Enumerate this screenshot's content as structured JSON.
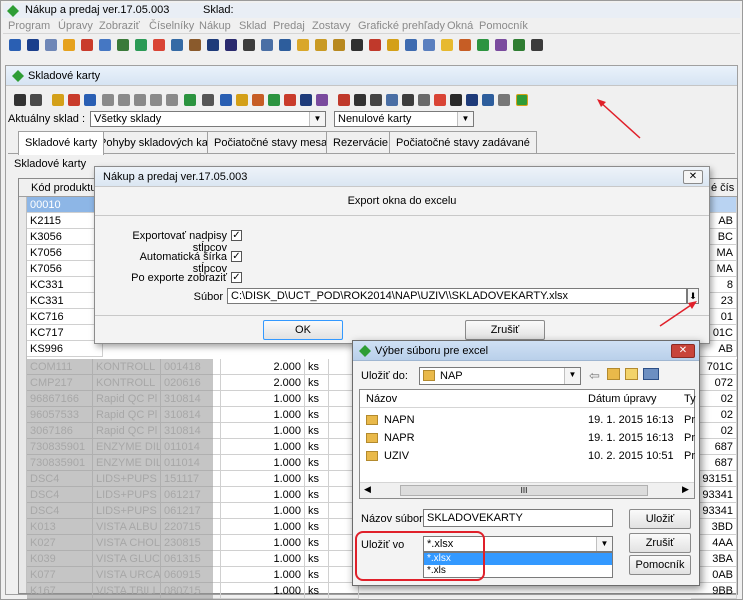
{
  "app": {
    "title": "Nákup a predaj ver.17.05.003",
    "sklad_label": "Sklad:"
  },
  "menu": [
    "Program",
    "Úpravy",
    "Zobraziť",
    "Číselníky",
    "Nákup",
    "Sklad",
    "Predaj",
    "Zostavy",
    "Grafické prehľady",
    "Okná",
    "Pomocník"
  ],
  "child": {
    "title": "Skladové karty",
    "sklad_label": "Aktuálny sklad :",
    "sklad_value": "Všetky sklady",
    "filter_value": "Nenulové karty",
    "grid_title": "Skladové karty",
    "col_kod": "Kód produktu",
    "col_right": "é čís"
  },
  "tabs": [
    "Skladové karty",
    "Pohyby skladových kariet",
    "Počiatočné stavy mesačné",
    "Rezervácie",
    "Počiatočné stavy zadávané"
  ],
  "rows_top": [
    {
      "kod": "00010",
      "r": ""
    },
    {
      "kod": "K2115",
      "r": "AB"
    },
    {
      "kod": "K3056",
      "r": "BC"
    },
    {
      "kod": "K7056",
      "r": "MA"
    },
    {
      "kod": "K7056",
      "r": "MA"
    },
    {
      "kod": "KC331",
      "r": "8"
    },
    {
      "kod": "KC331",
      "r": "23"
    },
    {
      "kod": "KC716",
      "r": "01"
    },
    {
      "kod": "KC717",
      "r": "01C"
    },
    {
      "kod": "KS996",
      "r": "AB"
    }
  ],
  "rows_bottom": [
    {
      "kod": "COM111",
      "nazov": "KONTROLL",
      "kod2": "001418",
      "qty": "2.000",
      "unit": "ks",
      "r": "701C"
    },
    {
      "kod": "CMP217",
      "nazov": "KONTROLL",
      "kod2": "020616",
      "qty": "2.000",
      "unit": "ks",
      "r": "072"
    },
    {
      "kod": "96867166",
      "nazov": "Rapid QC Pl",
      "kod2": "310814",
      "qty": "1.000",
      "unit": "ks",
      "r": "02"
    },
    {
      "kod": "96057533",
      "nazov": "Rapid QC Pl",
      "kod2": "310814",
      "qty": "1.000",
      "unit": "ks",
      "r": "02"
    },
    {
      "kod": "3067186",
      "nazov": "Rapid QC Pl",
      "kod2": "310814",
      "qty": "1.000",
      "unit": "ks",
      "r": "02"
    },
    {
      "kod": "730835901",
      "nazov": "ENZYME DIL",
      "kod2": "011014",
      "qty": "1.000",
      "unit": "ks",
      "r": "687"
    },
    {
      "kod": "730835901",
      "nazov": "ENZYME DIL",
      "kod2": "011014",
      "qty": "1.000",
      "unit": "ks",
      "r": "687"
    },
    {
      "kod": "DSC4",
      "nazov": "LIDS+PUPS",
      "kod2": "151117",
      "qty": "1.000",
      "unit": "ks",
      "r": "93151"
    },
    {
      "kod": "DSC4",
      "nazov": "LIDS+PUPS",
      "kod2": "061217",
      "qty": "1.000",
      "unit": "ks",
      "r": "93341"
    },
    {
      "kod": "DSC4",
      "nazov": "LIDS+PUPS",
      "kod2": "061217",
      "qty": "1.000",
      "unit": "ks",
      "r": "93341"
    },
    {
      "kod": "K013",
      "nazov": "VISTA ALBU",
      "kod2": "220715",
      "qty": "1.000",
      "unit": "ks",
      "r": "3BD"
    },
    {
      "kod": "K027",
      "nazov": "VISTA CHOL",
      "kod2": "230815",
      "qty": "1.000",
      "unit": "ks",
      "r": "4AA"
    },
    {
      "kod": "K039",
      "nazov": "VISTA GLUC",
      "kod2": "061315",
      "qty": "1.000",
      "unit": "ks",
      "r": "3BA"
    },
    {
      "kod": "K077",
      "nazov": "VISTA URCA",
      "kod2": "060915",
      "qty": "1.000",
      "unit": "ks",
      "r": "0AB"
    },
    {
      "kod": "K167",
      "nazov": "VISTA TBILI",
      "kod2": "080715",
      "qty": "1.000",
      "unit": "ks",
      "r": "9BB"
    }
  ],
  "export_dialog": {
    "title": "Nákup a predaj ver.17.05.003",
    "heading": "Export okna do excelu",
    "opt1": "Exportovať nadpisy stĺpcov",
    "opt2": "Automatická šírka stĺpcov",
    "opt3": "Po exporte zobraziť",
    "subor_label": "Súbor",
    "subor_value": "C:\\DISK_D\\UCT_POD\\ROK2014\\NAP\\UZIV\\\\SKLADOVEKARTY.xlsx",
    "ok": "OK",
    "cancel": "Zrušiť"
  },
  "file_dialog": {
    "title": "Výber súboru pre excel",
    "save_in_label": "Uložiť do:",
    "folder": "NAP",
    "col_name": "Názov",
    "col_date": "Dátum úpravy",
    "col_type": "Ty",
    "items": [
      {
        "name": "NAPN",
        "date": "19. 1. 2015 16:13",
        "type": "Pr"
      },
      {
        "name": "NAPR",
        "date": "19. 1. 2015 16:13",
        "type": "Pr"
      },
      {
        "name": "UZIV",
        "date": "10. 2. 2015 10:51",
        "type": "Pr"
      }
    ],
    "name_label": "Názov súboru:",
    "name_value": "SKLADOVEKARTY",
    "type_label": "Uložiť vo",
    "type_value": "*.xlsx",
    "type_options": [
      "*.xlsx",
      "*.xls"
    ],
    "save": "Uložiť",
    "cancel": "Zrušiť",
    "help": "Pomocník",
    "scroll_mark": "III"
  },
  "colors": {
    "accent": "#3399ff",
    "selection": "#3399ff",
    "annotation": "#e0202a"
  }
}
